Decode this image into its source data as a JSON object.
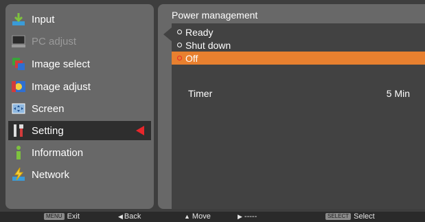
{
  "menu": {
    "items": [
      {
        "label": "Input",
        "icon": "input-icon",
        "state": "normal"
      },
      {
        "label": "PC adjust",
        "icon": "pc-adjust-icon",
        "state": "disabled"
      },
      {
        "label": "Image select",
        "icon": "image-select-icon",
        "state": "normal"
      },
      {
        "label": "Image adjust",
        "icon": "image-adjust-icon",
        "state": "normal"
      },
      {
        "label": "Screen",
        "icon": "screen-icon",
        "state": "normal"
      },
      {
        "label": "Setting",
        "icon": "setting-icon",
        "state": "selected"
      },
      {
        "label": "Information",
        "icon": "information-icon",
        "state": "normal"
      },
      {
        "label": "Network",
        "icon": "network-icon",
        "state": "normal"
      }
    ]
  },
  "panel": {
    "title": "Power management",
    "options": [
      {
        "label": "Ready",
        "selected": false
      },
      {
        "label": "Shut down",
        "selected": false
      },
      {
        "label": "Off",
        "selected": true
      }
    ],
    "timer_label": "Timer",
    "timer_value": "5 Min"
  },
  "footer": {
    "exit_key": "MENU",
    "exit_label": "Exit",
    "back_label": "Back",
    "move_label": "Move",
    "next_label": "-----",
    "select_key": "SELECT",
    "select_label": "Select"
  },
  "colors": {
    "highlight": "#e8802f",
    "pointer": "#e8262b"
  }
}
